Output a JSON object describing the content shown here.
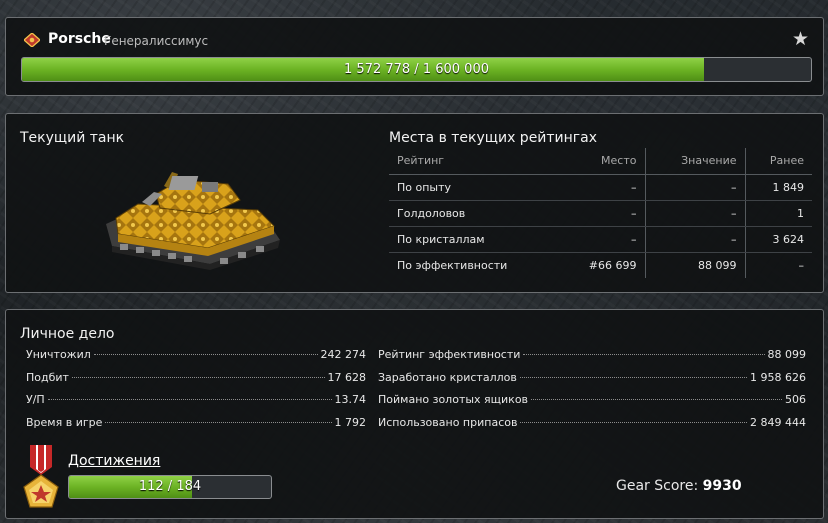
{
  "header": {
    "player_name": "Porsche",
    "rank": "Генералиссимус",
    "xp_text": "1 572 778 / 1 600 000",
    "xp_current": 1572778,
    "xp_max": 1600000,
    "star_icon": "star-icon",
    "rank_icon": "rank-insignia-icon"
  },
  "tank": {
    "title": "Текущий танк"
  },
  "ratings": {
    "title": "Места в текущих рейтингах",
    "columns": [
      "Рейтинг",
      "Место",
      "Значение",
      "Ранее"
    ],
    "rows": [
      [
        "По опыту",
        "–",
        "–",
        "1 849"
      ],
      [
        "Голдоловов",
        "–",
        "–",
        "1"
      ],
      [
        "По кристаллам",
        "–",
        "–",
        "3 624"
      ],
      [
        "По эффективности",
        "#66 699",
        "88 099",
        "–"
      ]
    ]
  },
  "personal": {
    "title": "Личное дело",
    "left_stats": [
      {
        "label": "Уничтожил",
        "value": "242 274"
      },
      {
        "label": "Подбит",
        "value": "17 628"
      },
      {
        "label": "У/П",
        "value": "13.74"
      },
      {
        "label": "Время в игре",
        "value": "1 792"
      }
    ],
    "right_stats": [
      {
        "label": "Рейтинг эффективности",
        "value": "88 099"
      },
      {
        "label": "Заработано кристаллов",
        "value": "1 958 626"
      },
      {
        "label": "Поймано золотых ящиков",
        "value": "506"
      },
      {
        "label": "Использовано припасов",
        "value": "2 849 444"
      }
    ]
  },
  "achievements": {
    "label": "Достижения",
    "progress_text": "112 / 184",
    "current": 112,
    "total": 184,
    "medal_icon": "medal-icon"
  },
  "gear": {
    "label": "Gear Score:",
    "value": "9930"
  },
  "colors": {
    "progress_green": "#6cb324",
    "panel_bg": "#101214",
    "border": "#6c6f72"
  }
}
